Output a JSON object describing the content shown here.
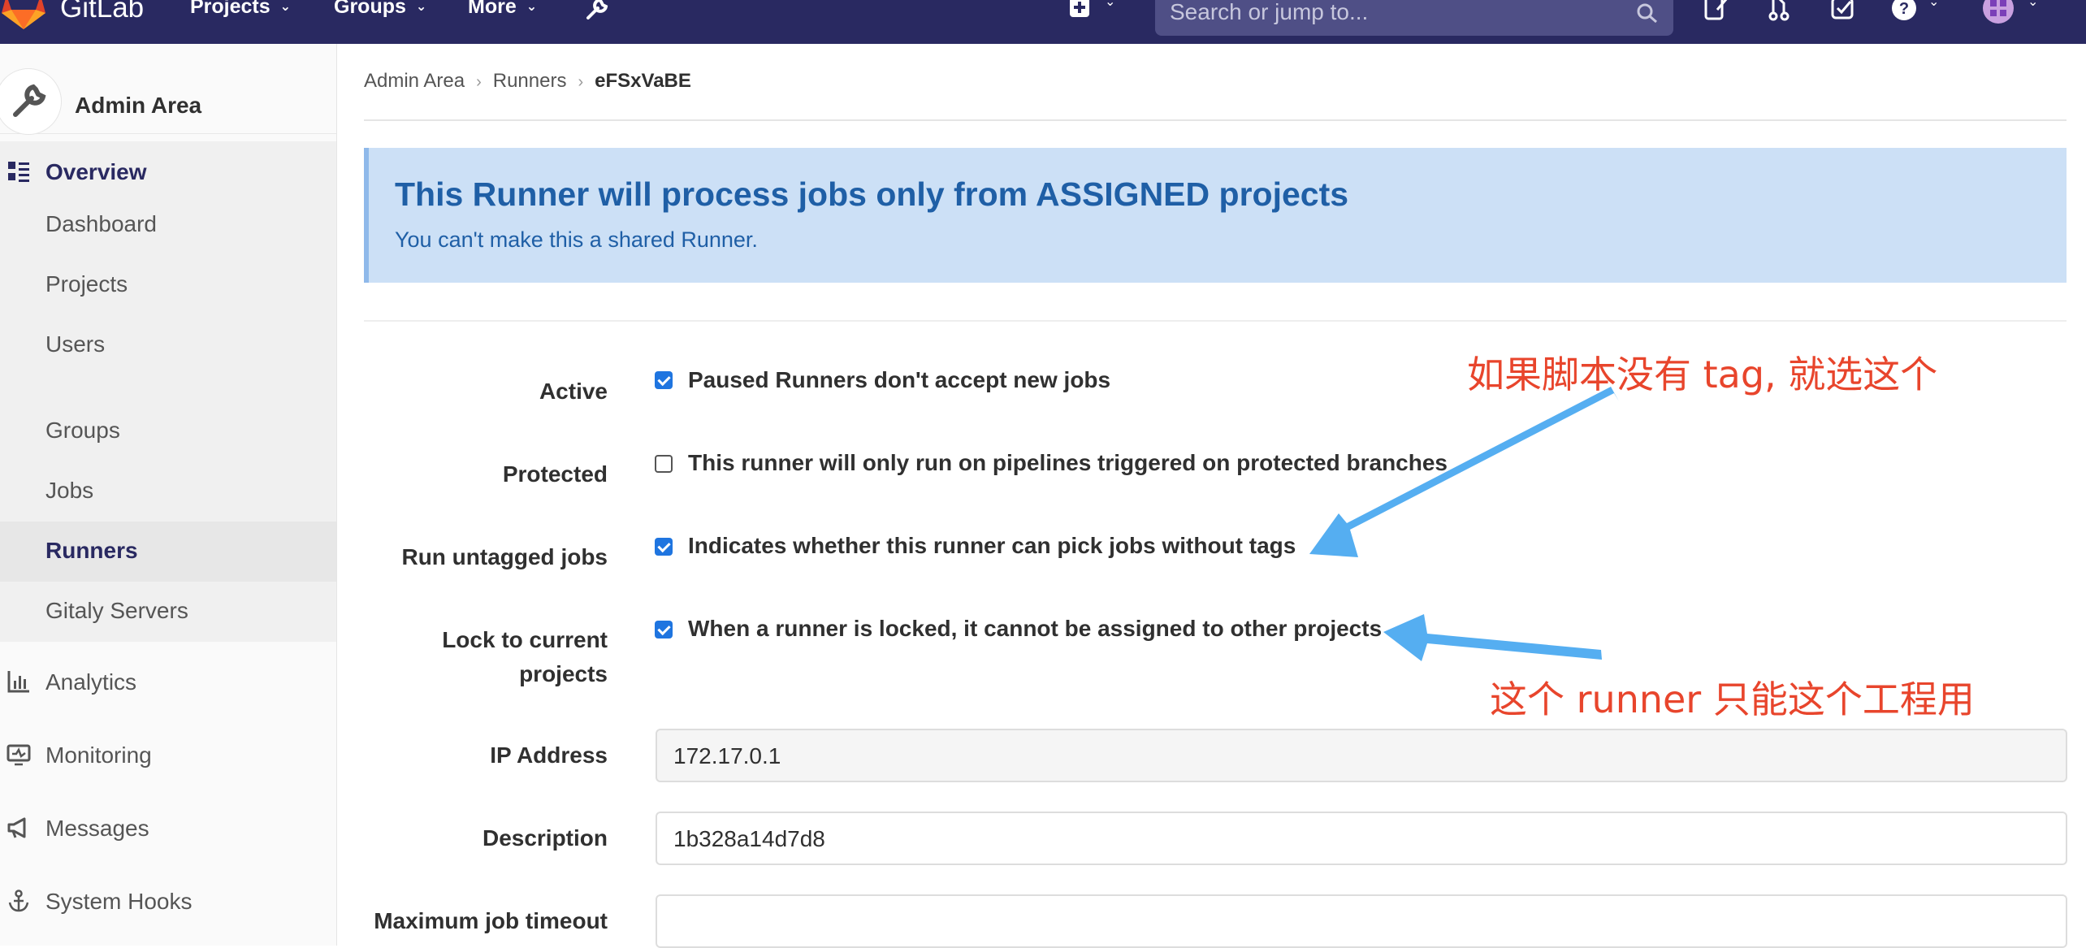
{
  "header": {
    "brand": "GitLab",
    "nav": [
      "Projects",
      "Groups",
      "More"
    ],
    "search_placeholder": "Search or jump to..."
  },
  "sidebar": {
    "title": "Admin Area",
    "overview": "Overview",
    "items": [
      "Dashboard",
      "Projects",
      "Users",
      "Groups",
      "Jobs",
      "Runners",
      "Gitaly Servers"
    ],
    "active": "Runners",
    "sections": [
      "Analytics",
      "Monitoring",
      "Messages",
      "System Hooks"
    ]
  },
  "breadcrumb": [
    "Admin Area",
    "Runners",
    "eFSxVaBE"
  ],
  "alert": {
    "title": "This Runner will process jobs only from ASSIGNED projects",
    "text": "You can't make this a shared Runner."
  },
  "form": {
    "active": {
      "label": "Active",
      "text": "Paused Runners don't accept new jobs",
      "checked": true
    },
    "protected": {
      "label": "Protected",
      "text": "This runner will only run on pipelines triggered on protected branches",
      "checked": false
    },
    "untagged": {
      "label": "Run untagged jobs",
      "text": "Indicates whether this runner can pick jobs without tags",
      "checked": true
    },
    "locked": {
      "label_line1": "Lock to current",
      "label_line2": "projects",
      "text": "When a runner is locked, it cannot be assigned to other projects",
      "checked": true
    },
    "ip": {
      "label": "IP Address",
      "value": "172.17.0.1"
    },
    "description": {
      "label": "Description",
      "value": "1b328a14d7d8"
    },
    "timeout": {
      "label": "Maximum job timeout",
      "value": ""
    }
  },
  "annotations": {
    "top": "如果脚本没有 tag, 就选这个",
    "bottom": "这个 runner 只能这个工程用"
  },
  "colors": {
    "header": "#292961",
    "alert_bg": "#cce0f6",
    "checkbox": "#1f75e0",
    "annotation_text": "#e8452c",
    "annotation_arrow": "#55aef1"
  }
}
